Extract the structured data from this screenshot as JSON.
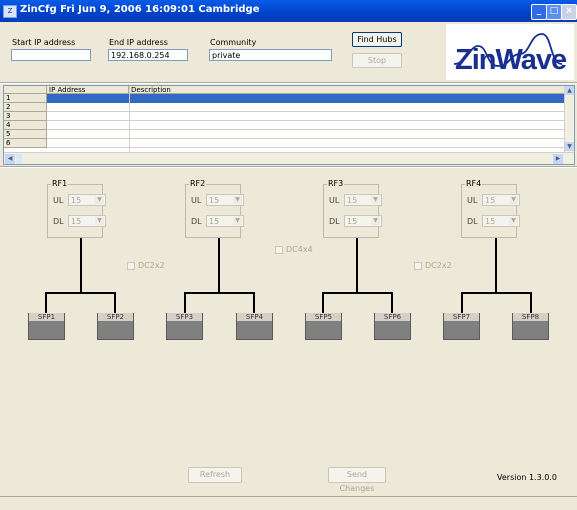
{
  "window": {
    "title": "ZinCfg   Fri Jun 9, 2006 16:09:01 Cambridge",
    "icon": "app-icon",
    "controls": {
      "minimize": "_",
      "maximize": "□",
      "close": "×"
    }
  },
  "fields": {
    "start_ip_label": "Start IP address",
    "start_ip_value": "",
    "end_ip_label": "End IP address",
    "end_ip_value": "192.168.0.254",
    "community_label": "Community",
    "community_value": "private"
  },
  "buttons": {
    "find_hubs": "Find Hubs",
    "stop": "Stop",
    "refresh": "Refresh",
    "send_changes": "Send Changes"
  },
  "logo": {
    "text": "ZinWave"
  },
  "grid": {
    "columns": [
      "IP Address",
      "Description"
    ],
    "rows": [
      "1",
      "2",
      "3",
      "4",
      "5",
      "6"
    ],
    "selected_row": 1
  },
  "rf": [
    {
      "label": "RF1",
      "ul_label": "UL",
      "ul_value": "15",
      "dl_label": "DL",
      "dl_value": "15"
    },
    {
      "label": "RF2",
      "ul_label": "UL",
      "ul_value": "15",
      "dl_label": "DL",
      "dl_value": "15"
    },
    {
      "label": "RF3",
      "ul_label": "UL",
      "ul_value": "15",
      "dl_label": "DL",
      "dl_value": "15"
    },
    {
      "label": "RF4",
      "ul_label": "UL",
      "ul_value": "15",
      "dl_label": "DL",
      "dl_value": "15"
    }
  ],
  "combiners": [
    "DC2x2",
    "DC4x4",
    "DC2x2"
  ],
  "sfps": [
    "SFP1",
    "SFP2",
    "SFP3",
    "SFP4",
    "SFP5",
    "SFP6",
    "SFP7",
    "SFP8"
  ],
  "version": "Version 1.3.0.0",
  "colors": {
    "titlebar": "#0050e0",
    "selection": "#316ac5",
    "logo_text": "#1a2f8f",
    "panel": "#ece9d8"
  }
}
